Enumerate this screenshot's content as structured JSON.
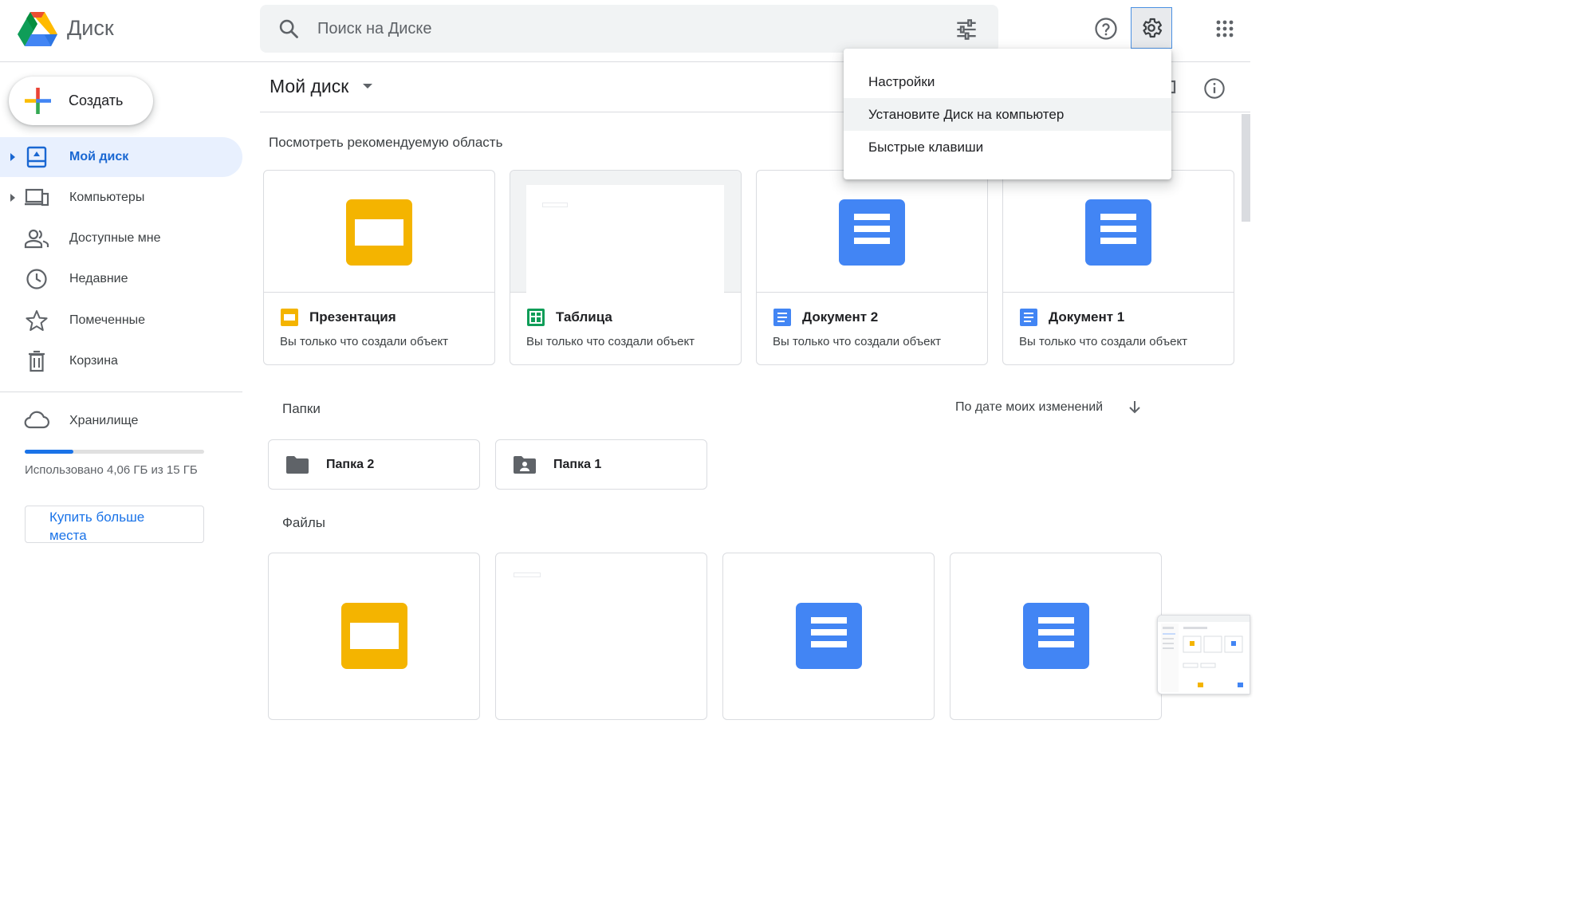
{
  "header": {
    "app_name": "Диск",
    "search_placeholder": "Поиск на Диске"
  },
  "menu": {
    "items": [
      {
        "label": "Настройки"
      },
      {
        "label": "Установите Диск на компьютер"
      },
      {
        "label": "Быстрые клавиши"
      }
    ]
  },
  "sidebar": {
    "create_label": "Создать",
    "items": [
      {
        "label": "Мой диск",
        "icon": "my-drive-icon"
      },
      {
        "label": "Компьютеры",
        "icon": "computers-icon"
      },
      {
        "label": "Доступные мне",
        "icon": "shared-icon"
      },
      {
        "label": "Недавние",
        "icon": "clock-icon"
      },
      {
        "label": "Помеченные",
        "icon": "star-icon"
      },
      {
        "label": "Корзина",
        "icon": "trash-icon"
      }
    ],
    "storage": {
      "label": "Хранилище",
      "used_text": "Использовано 4,06 ГБ из 15 ГБ",
      "used_fraction": 0.27,
      "buy_label": "Купить больше места"
    }
  },
  "main": {
    "title": "Мой диск",
    "suggested_label": "Посмотреть рекомендуемую область",
    "suggested": [
      {
        "name": "Презентация",
        "subtitle": "Вы только что создали объект",
        "type": "slides"
      },
      {
        "name": "Таблица",
        "subtitle": "Вы только что создали объект",
        "type": "sheets"
      },
      {
        "name": "Документ 2",
        "subtitle": "Вы только что создали объект",
        "type": "docs"
      },
      {
        "name": "Документ 1",
        "subtitle": "Вы только что создали объект",
        "type": "docs"
      }
    ],
    "folders_label": "Папки",
    "sort_label": "По дате моих изменений",
    "folders": [
      {
        "name": "Папка 2",
        "icon": "folder-icon"
      },
      {
        "name": "Папка 1",
        "icon": "shared-folder-icon"
      }
    ],
    "files_label": "Файлы",
    "files": [
      {
        "type": "slides"
      },
      {
        "type": "sheets"
      },
      {
        "type": "docs"
      },
      {
        "type": "docs"
      }
    ]
  },
  "colors": {
    "accent": "#1a73e8",
    "slides": "#f4b400",
    "docs": "#4285f4",
    "sheets": "#0f9d58",
    "active_bg": "#e8f0fe"
  }
}
